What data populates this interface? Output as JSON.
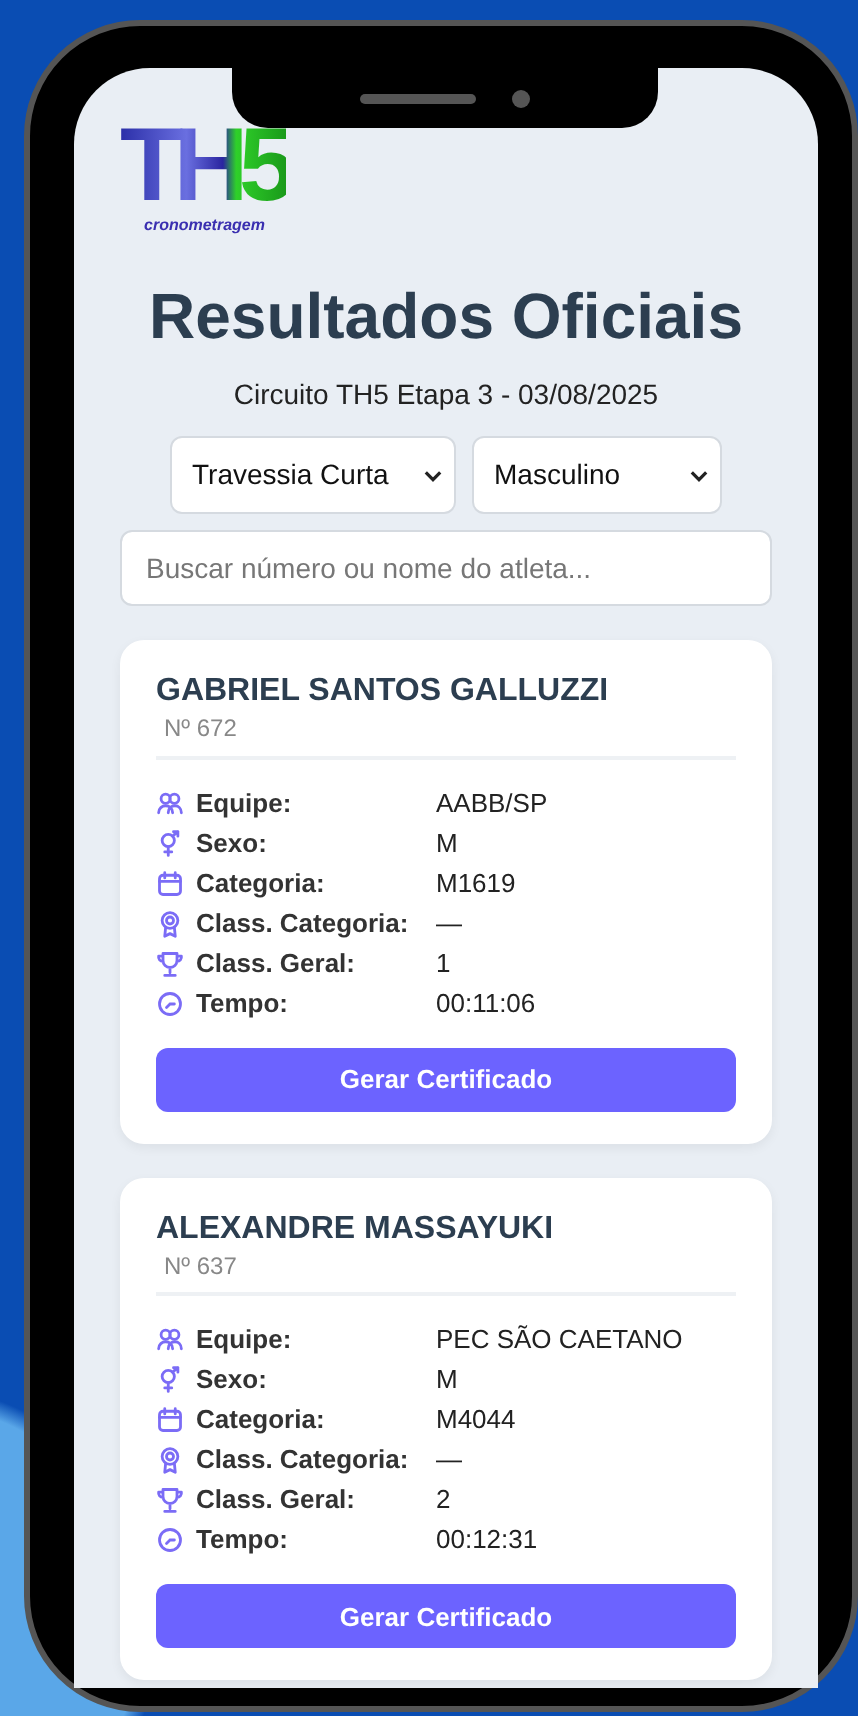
{
  "logo": {
    "mark": "TH5",
    "tagline": "cronometragem"
  },
  "title": "Resultados Oficiais",
  "subtitle": "Circuito TH5 Etapa 3 - 03/08/2025",
  "filters": [
    {
      "value": "Travessia Curta"
    },
    {
      "value": "Masculino"
    }
  ],
  "search": {
    "placeholder": "Buscar número ou nome do atleta..."
  },
  "athletes": [
    {
      "name": "GABRIEL SANTOS GALLUZZI",
      "number": "Nº 672",
      "fields": [
        {
          "kind": "team",
          "label": "Equipe:",
          "value": "AABB/SP"
        },
        {
          "kind": "gender",
          "label": "Sexo:",
          "value": "M"
        },
        {
          "kind": "calendar",
          "label": "Categoria:",
          "value": "M1619"
        },
        {
          "kind": "medal",
          "label": "Class. Categoria:",
          "value": "—"
        },
        {
          "kind": "trophy",
          "label": "Class. Geral:",
          "value": "1"
        },
        {
          "kind": "clock",
          "label": "Tempo:",
          "value": "00:11:06"
        }
      ],
      "button": "Gerar Certificado"
    },
    {
      "name": "ALEXANDRE MASSAYUKI",
      "number": "Nº 637",
      "fields": [
        {
          "kind": "team",
          "label": "Equipe:",
          "value": "PEC SÃO CAETANO"
        },
        {
          "kind": "gender",
          "label": "Sexo:",
          "value": "M"
        },
        {
          "kind": "calendar",
          "label": "Categoria:",
          "value": "M4044"
        },
        {
          "kind": "medal",
          "label": "Class. Categoria:",
          "value": "—"
        },
        {
          "kind": "trophy",
          "label": "Class. Geral:",
          "value": "2"
        },
        {
          "kind": "clock",
          "label": "Tempo:",
          "value": "00:12:31"
        }
      ],
      "button": "Gerar Certificado"
    }
  ]
}
